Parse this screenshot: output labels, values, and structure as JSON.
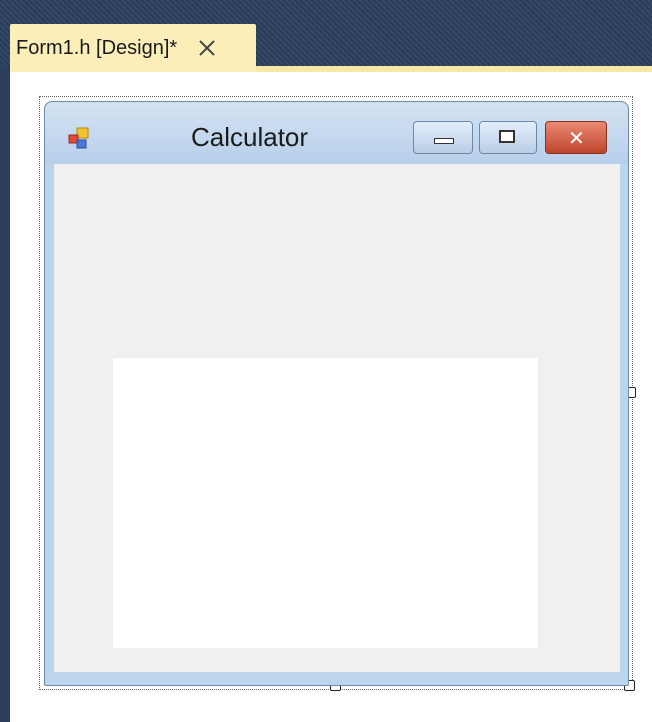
{
  "document_tab": {
    "title": "Form1.h [Design]*",
    "close_glyph": "×"
  },
  "form": {
    "title": "Calculator",
    "icon": "form-app-icon",
    "caption_buttons": {
      "minimize_icon": "minimize-icon",
      "maximize_icon": "maximize-icon",
      "close_label": "✕"
    }
  },
  "colors": {
    "tab_strip_bg": "#2c3d5e",
    "active_tab_bg": "#fbeeb8",
    "window_frame": "#bcd4ec",
    "client_area": "#f0f0f0",
    "text_display": "#ffffff",
    "close_button": "#c0452d"
  }
}
